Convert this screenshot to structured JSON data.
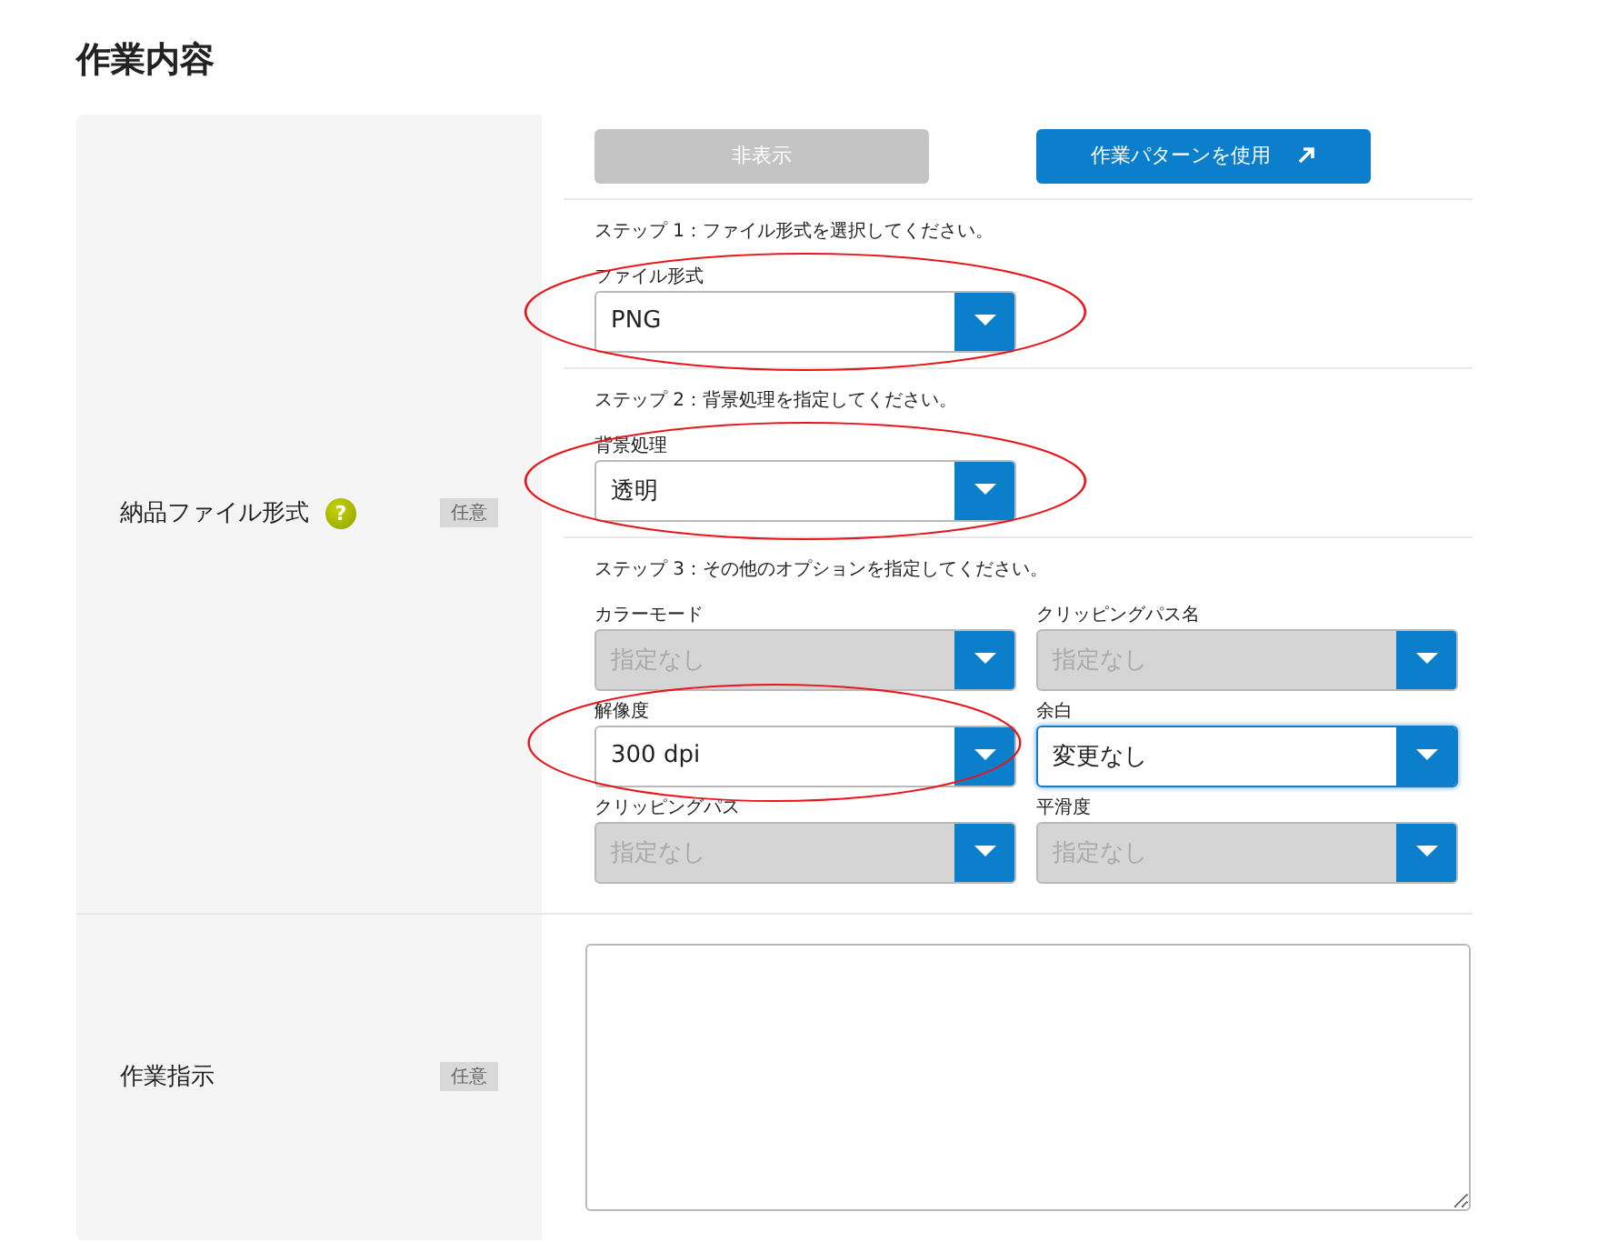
{
  "page_title": "作業内容",
  "format_section": {
    "label": "納品ファイル形式",
    "help_icon": "?",
    "badge": "任意",
    "buttons": [
      {
        "label": "非表示",
        "disabled": true,
        "kind": "plain"
      },
      {
        "label": "作業パターンを使用",
        "disabled": false,
        "kind": "external"
      }
    ],
    "steps": [
      {
        "instruction": "ステップ 1：ファイル形式を選択してください。",
        "fields": [
          {
            "label": "ファイル形式",
            "value": "PNG",
            "disabled": false,
            "focused": false,
            "circled": true
          }
        ]
      },
      {
        "instruction": "ステップ 2：背景処理を指定してください。",
        "fields": [
          {
            "label": "背景処理",
            "value": "透明",
            "disabled": false,
            "focused": false,
            "circled": true
          }
        ]
      },
      {
        "instruction": "ステップ 3：その他のオプションを指定してください。",
        "fields": [
          {
            "label": "カラーモード",
            "value": "指定なし",
            "disabled": true,
            "focused": false,
            "circled": false
          },
          {
            "label": "クリッピングパス名",
            "value": "指定なし",
            "disabled": true,
            "focused": false,
            "circled": false
          },
          {
            "label": "解像度",
            "value": "300 dpi",
            "disabled": false,
            "focused": false,
            "circled": true
          },
          {
            "label": "余白",
            "value": "変更なし",
            "disabled": false,
            "focused": true,
            "circled": false
          },
          {
            "label": "クリッピングパス",
            "value": "指定なし",
            "disabled": true,
            "focused": false,
            "circled": false
          },
          {
            "label": "平滑度",
            "value": "指定なし",
            "disabled": true,
            "focused": false,
            "circled": false
          }
        ]
      }
    ]
  },
  "instructions_section": {
    "label": "作業指示",
    "badge": "任意"
  }
}
